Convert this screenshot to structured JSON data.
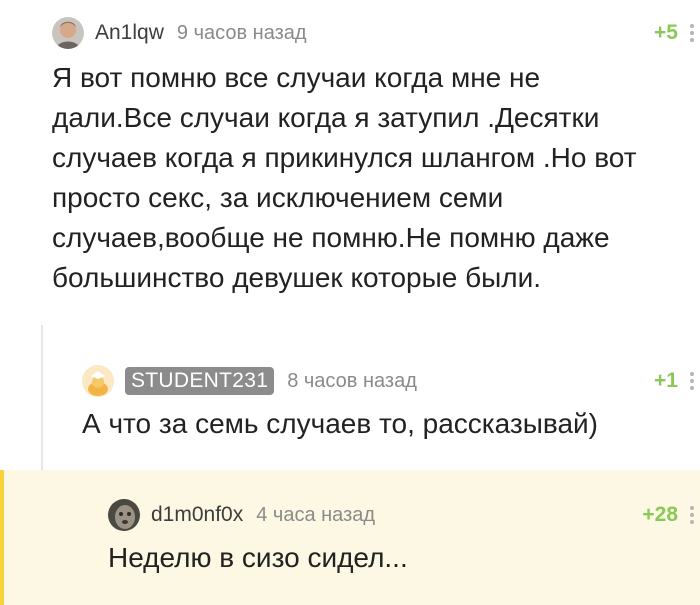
{
  "comments": [
    {
      "username": "An1lqw",
      "time": "9 часов назад",
      "rating": "+5",
      "text": "Я вот помню все случаи когда мне не дали.Все случаи когда я затупил .Десятки случаев когда я прикинулся шлангом .Но вот просто секс, за исключением семи случаев,вообще не помню.Не помню даже большинство девушек которые были."
    },
    {
      "username": "STUDENT231",
      "time": "8 часов назад",
      "rating": "+1",
      "text": "А что за семь случаев то, рассказывай)"
    },
    {
      "username": "d1m0nf0x",
      "time": "4 часа назад",
      "rating": "+28",
      "text": "Неделю в сизо сидел..."
    }
  ],
  "colors": {
    "rating": "#8ac858",
    "highlight_bar": "#f6d33c",
    "highlight_background": "#fcf8e3",
    "username_badge": "#8c8c8c"
  }
}
